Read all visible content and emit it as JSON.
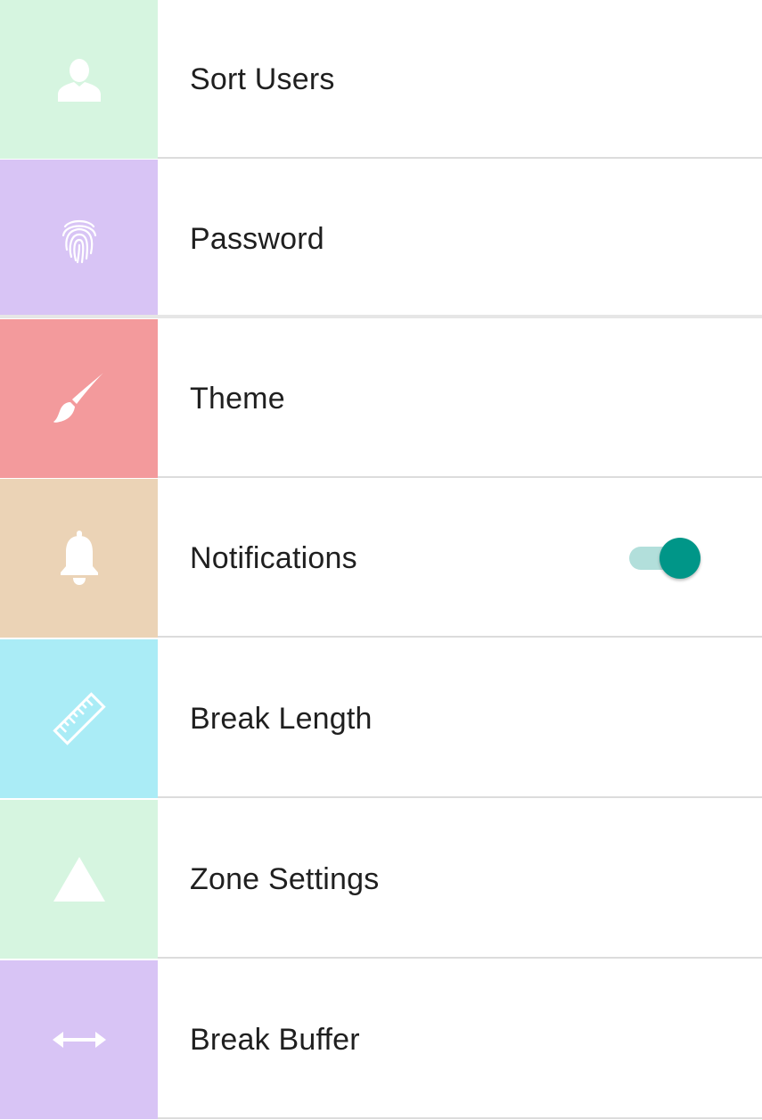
{
  "settings": {
    "items": [
      {
        "label": "Sort Users",
        "icon": "person-icon",
        "color": "#d6f5e0"
      },
      {
        "label": "Password",
        "icon": "fingerprint-icon",
        "color": "#d8c4f5"
      },
      {
        "label": "Theme",
        "icon": "paintbrush-icon",
        "color": "#f39a9c"
      },
      {
        "label": "Notifications",
        "icon": "bell-icon",
        "color": "#ebd3b6",
        "toggle": {
          "on": true,
          "track_color": "#b2dfdb",
          "thumb_color": "#009688"
        }
      },
      {
        "label": "Break Length",
        "icon": "ruler-icon",
        "color": "#aaecf6"
      },
      {
        "label": "Zone Settings",
        "icon": "triangle-icon",
        "color": "#d6f5e0"
      },
      {
        "label": "Break Buffer",
        "icon": "horizontal-arrows-icon",
        "color": "#d8c4f5"
      }
    ]
  }
}
